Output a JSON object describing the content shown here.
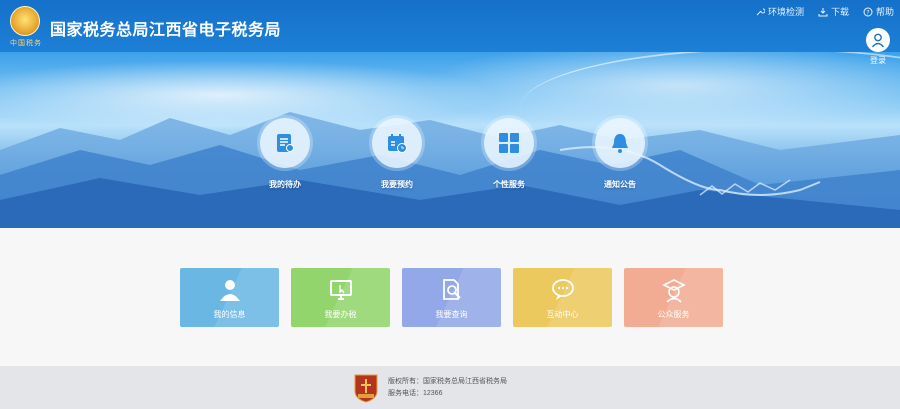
{
  "header": {
    "site_title": "国家税务总局江西省电子税务局",
    "emblem_text": "中国税务",
    "links": [
      {
        "label": "环境检测",
        "icon": "wrench-icon"
      },
      {
        "label": "下载",
        "icon": "download-icon"
      },
      {
        "label": "帮助",
        "icon": "help-icon"
      }
    ],
    "login_label": "登录"
  },
  "shortcuts": [
    {
      "label": "我的待办",
      "icon": "todo-list-icon"
    },
    {
      "label": "我要预约",
      "icon": "calendar-clock-icon"
    },
    {
      "label": "个性服务",
      "icon": "grid-icon"
    },
    {
      "label": "通知公告",
      "icon": "bell-icon"
    }
  ],
  "cards": [
    {
      "label": "我的信息",
      "icon": "user-icon",
      "color": "#6ab7e4"
    },
    {
      "label": "我要办税",
      "icon": "monitor-icon",
      "color": "#93d56d"
    },
    {
      "label": "我要查询",
      "icon": "search-doc-icon",
      "color": "#93a8e8"
    },
    {
      "label": "互动中心",
      "icon": "chat-icon",
      "color": "#ecc95f"
    },
    {
      "label": "公众服务",
      "icon": "graduate-icon",
      "color": "#f2ac94"
    }
  ],
  "footer": {
    "copyright": "版权所有：国家税务总局江西省税务局",
    "phone": "服务电话：12366"
  },
  "colors": {
    "header_blue": "#1570c9",
    "page_bg": "#f7f7f8",
    "footer_bg": "#e4e5e8",
    "shortcut_icon_blue": "#2f8ee0"
  }
}
